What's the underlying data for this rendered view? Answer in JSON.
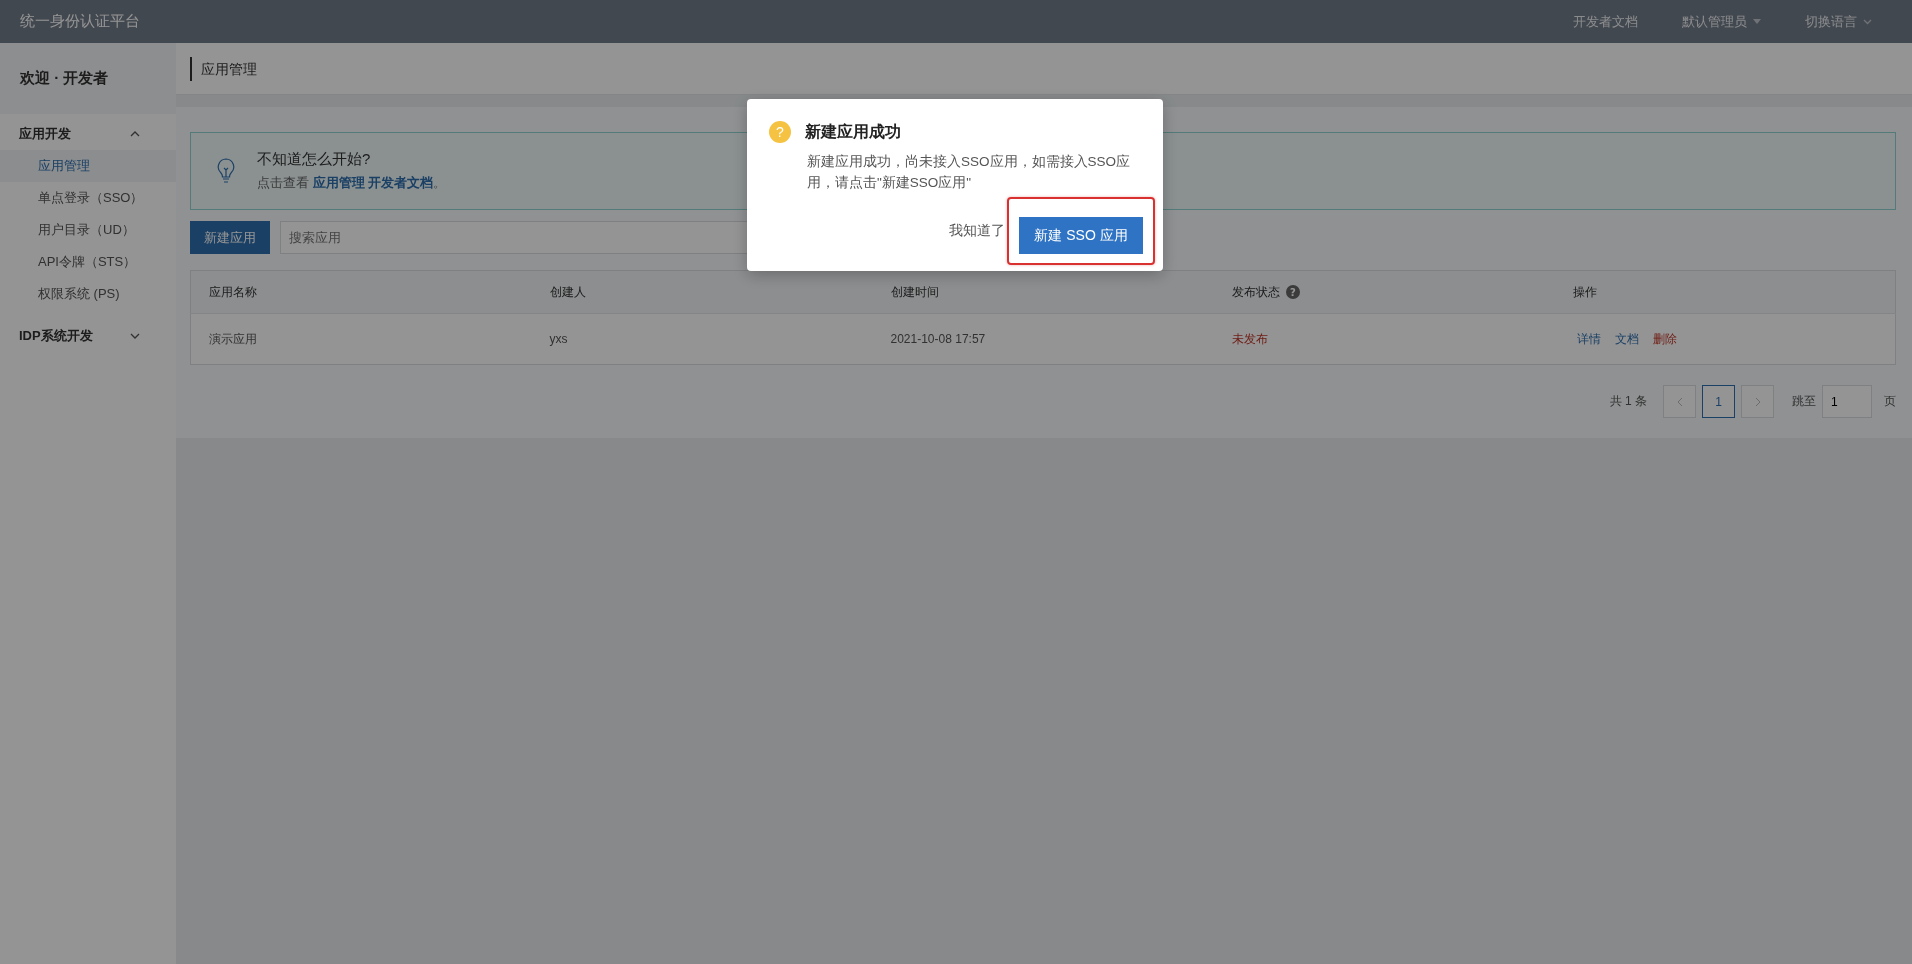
{
  "topbar": {
    "title": "统一身份认证平台",
    "links": [
      {
        "label": "开发者文档",
        "kind": "link"
      },
      {
        "label": "默认管理员",
        "kind": "dropdown"
      },
      {
        "label": "切换语言",
        "kind": "menu"
      }
    ]
  },
  "sidebar": {
    "welcome": "欢迎 · 开发者",
    "groups": [
      {
        "label": "应用开发",
        "expanded": true,
        "items": [
          {
            "label": "应用管理",
            "selected": true
          },
          {
            "label": "单点登录（SSO）",
            "selected": false
          },
          {
            "label": "用户目录（UD）",
            "selected": false
          },
          {
            "label": "API令牌（STS）",
            "selected": false
          },
          {
            "label": "权限系统 (PS)",
            "selected": false
          }
        ]
      },
      {
        "label": "IDP系统开发",
        "expanded": false
      }
    ]
  },
  "page_header": {
    "title": "应用管理"
  },
  "tip": {
    "title": "不知道怎么开始?",
    "prefix": "点击查看 ",
    "link": "应用管理 开发者文档",
    "suffix": "。"
  },
  "toolbar": {
    "new_button": "新建应用",
    "search": {
      "placeholder": "搜索应用"
    }
  },
  "table": {
    "columns": [
      {
        "label": "应用名称",
        "help": false
      },
      {
        "label": "创建人",
        "help": false
      },
      {
        "label": "创建时间",
        "help": false
      },
      {
        "label": "发布状态",
        "help": true
      },
      {
        "label": "操作",
        "help": false
      }
    ],
    "rows": [
      {
        "name": "演示应用",
        "creator": "yxs",
        "created": "2021-10-08 17:57",
        "status": {
          "label": "未发布",
          "published": false
        },
        "actions": [
          {
            "label": "详情",
            "kind": "link"
          },
          {
            "label": "文档",
            "kind": "link"
          },
          {
            "label": "删除",
            "kind": "danger"
          }
        ]
      }
    ]
  },
  "pagination": {
    "total": "共 1 条",
    "pages": [
      {
        "label": "1",
        "selected": true
      }
    ],
    "jump_label": "跳至",
    "jump_value": "1",
    "page_suffix": "页"
  },
  "dialog": {
    "icon": "?",
    "title": "新建应用成功",
    "message": "新建应用成功，尚未接入SSO应用，如需接入SSO应用，请点击\"新建SSO应用\"",
    "buttons": [
      {
        "label": "我知道了",
        "kind": "text",
        "highlighted": false
      },
      {
        "label": "新建 SSO 应用",
        "kind": "primary",
        "highlighted": true
      }
    ]
  }
}
